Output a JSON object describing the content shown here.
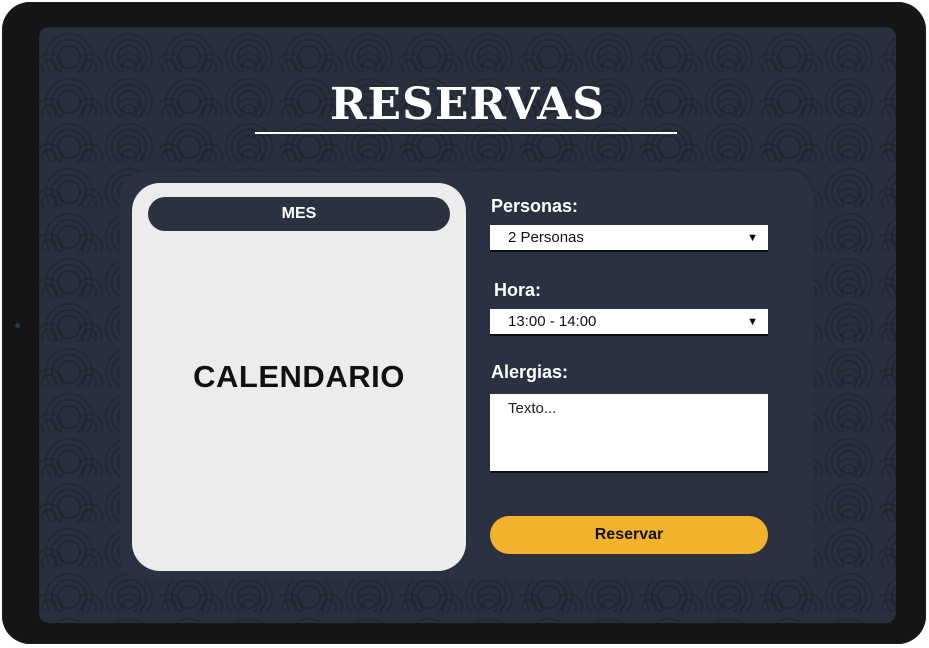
{
  "page": {
    "title": "RESERVAS"
  },
  "calendar": {
    "month_label": "MES",
    "placeholder": "CALENDARIO"
  },
  "form": {
    "personas": {
      "label": "Personas:",
      "selected": "2 Personas"
    },
    "hora": {
      "label": "Hora:",
      "selected": "13:00 - 14:00"
    },
    "alergias": {
      "label": "Alergias:",
      "placeholder": "Texto..."
    },
    "submit_label": "Reservar"
  },
  "colors": {
    "background": "#2a2f3d",
    "panel": "#2b3140",
    "card": "#ececec",
    "accent": "#f2b32c"
  },
  "icons": {
    "dropdown": "chevron-down-icon"
  }
}
